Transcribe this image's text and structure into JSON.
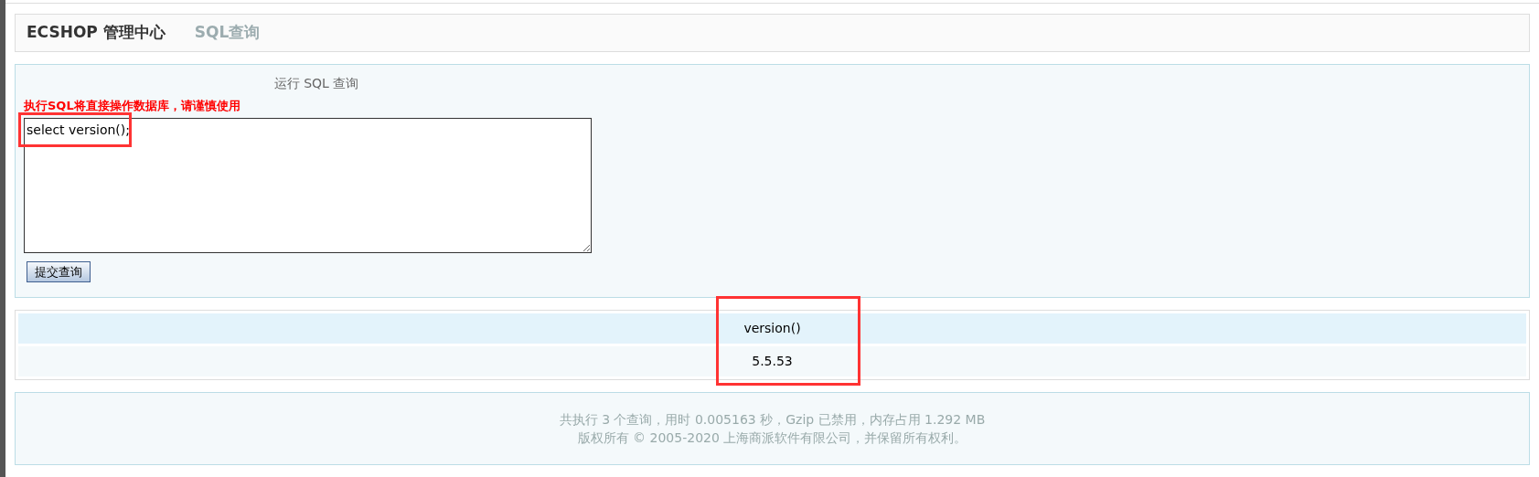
{
  "header": {
    "title": "ECSHOP 管理中心",
    "subtitle": "SQL查询"
  },
  "query_panel": {
    "heading": "运行 SQL 查询",
    "warning": "执行SQL将直接操作数据库，请谨慎使用",
    "query": "select version();",
    "submit_button": "提交查询",
    "highlighted": true
  },
  "result_table": {
    "columns": [
      "version()"
    ],
    "rows": [
      [
        "5.5.53"
      ]
    ],
    "highlighted": true
  },
  "footer": {
    "lines": [
      "共执行 3 个查询，用时 0.005163 秒，Gzip 已禁用，内存占用 1.292 MB",
      "版权所有 © 2005-2020 上海商派软件有限公司，并保留所有权利。"
    ]
  }
}
